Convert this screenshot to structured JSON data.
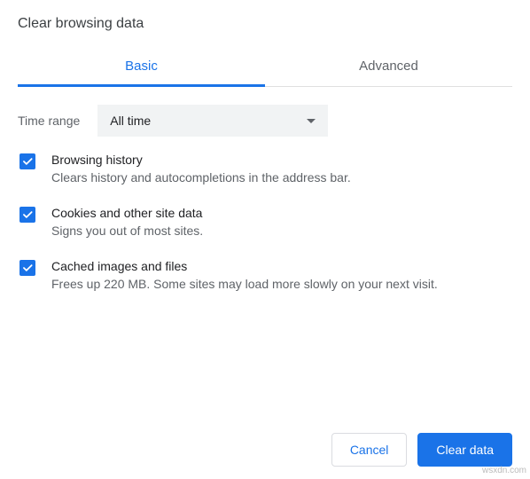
{
  "title": "Clear browsing data",
  "tabs": {
    "basic": "Basic",
    "advanced": "Advanced"
  },
  "time_range": {
    "label": "Time range",
    "value": "All time"
  },
  "options": [
    {
      "title": "Browsing history",
      "description": "Clears history and autocompletions in the address bar.",
      "checked": true
    },
    {
      "title": "Cookies and other site data",
      "description": "Signs you out of most sites.",
      "checked": true
    },
    {
      "title": "Cached images and files",
      "description": "Frees up 220 MB. Some sites may load more slowly on your next visit.",
      "checked": true
    }
  ],
  "buttons": {
    "cancel": "Cancel",
    "clear": "Clear data"
  },
  "watermark": "wsxdn.com"
}
